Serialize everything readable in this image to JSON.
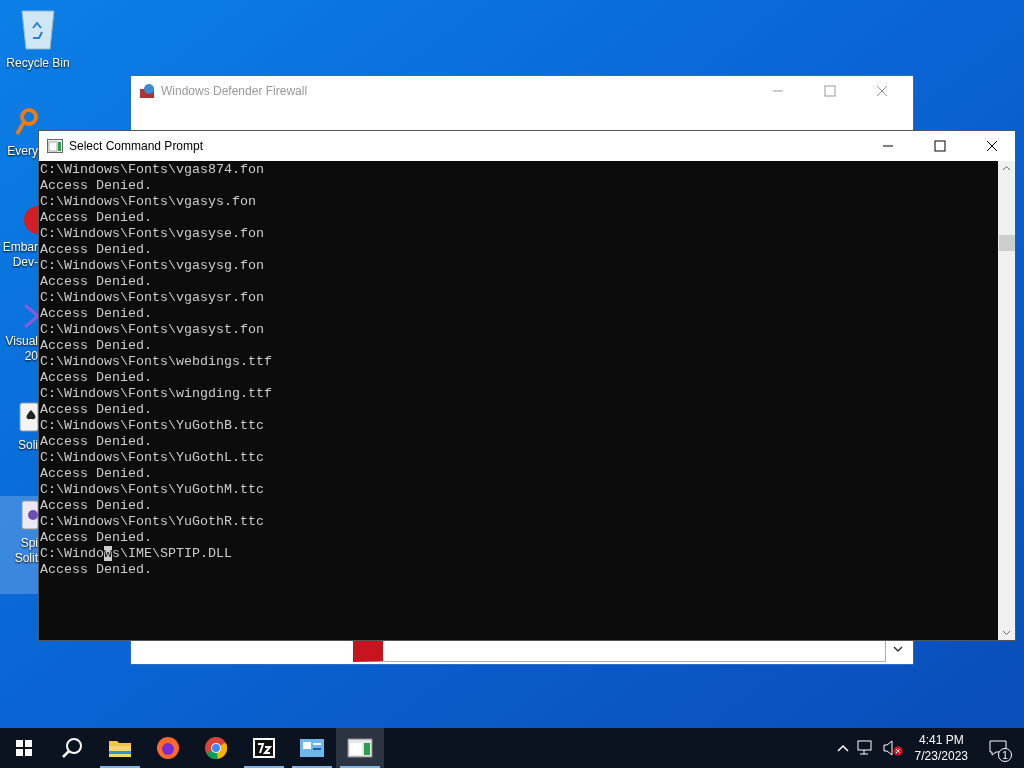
{
  "desktop_icons": [
    {
      "kind": "recycle",
      "lines": [
        "Recycle Bin"
      ],
      "selected": false
    },
    {
      "kind": "search",
      "lines": [
        "Every"
      ],
      "selected": false
    },
    {
      "kind": "devcpp",
      "lines": [
        "Embar",
        "Dev-"
      ],
      "selected": false
    },
    {
      "kind": "visual",
      "lines": [
        "Visual",
        "20"
      ],
      "selected": false
    },
    {
      "kind": "cards",
      "lines": [
        "Soli"
      ],
      "selected": false
    },
    {
      "kind": "spider",
      "lines": [
        "Spi",
        "Solit"
      ],
      "selected": true
    }
  ],
  "firewall_window": {
    "title": "Windows Defender Firewall"
  },
  "command_window": {
    "title": "Select Command Prompt",
    "lines": [
      {
        "segments": [
          {
            "text": "C:\\Windows\\Fonts\\vgas874.fon",
            "selected": false
          }
        ]
      },
      {
        "segments": [
          {
            "text": "Access Denied.",
            "selected": false
          }
        ]
      },
      {
        "segments": [
          {
            "text": "C:\\Windows\\Fonts\\vgasys.fon",
            "selected": false
          }
        ]
      },
      {
        "segments": [
          {
            "text": "Access Denied.",
            "selected": false
          }
        ]
      },
      {
        "segments": [
          {
            "text": "C:\\Windows\\Fonts\\vgasyse.fon",
            "selected": false
          }
        ]
      },
      {
        "segments": [
          {
            "text": "Access Denied.",
            "selected": false
          }
        ]
      },
      {
        "segments": [
          {
            "text": "C:\\Windows\\Fonts\\vgasysg.fon",
            "selected": false
          }
        ]
      },
      {
        "segments": [
          {
            "text": "Access Denied.",
            "selected": false
          }
        ]
      },
      {
        "segments": [
          {
            "text": "C:\\Windows\\Fonts\\vgasysr.fon",
            "selected": false
          }
        ]
      },
      {
        "segments": [
          {
            "text": "Access Denied.",
            "selected": false
          }
        ]
      },
      {
        "segments": [
          {
            "text": "C:\\Windows\\Fonts\\vgasyst.fon",
            "selected": false
          }
        ]
      },
      {
        "segments": [
          {
            "text": "Access Denied.",
            "selected": false
          }
        ]
      },
      {
        "segments": [
          {
            "text": "C:\\Windows\\Fonts\\webdings.ttf",
            "selected": false
          }
        ]
      },
      {
        "segments": [
          {
            "text": "Access Denied.",
            "selected": false
          }
        ]
      },
      {
        "segments": [
          {
            "text": "C:\\Windows\\Fonts\\wingding.ttf",
            "selected": false
          }
        ]
      },
      {
        "segments": [
          {
            "text": "Access Denied.",
            "selected": false
          }
        ]
      },
      {
        "segments": [
          {
            "text": "C:\\Windows\\Fonts\\YuGothB.ttc",
            "selected": false
          }
        ]
      },
      {
        "segments": [
          {
            "text": "Access Denied.",
            "selected": false
          }
        ]
      },
      {
        "segments": [
          {
            "text": "C:\\Windows\\Fonts\\YuGothL.ttc",
            "selected": false
          }
        ]
      },
      {
        "segments": [
          {
            "text": "Access Denied.",
            "selected": false
          }
        ]
      },
      {
        "segments": [
          {
            "text": "C:\\Windows\\Fonts\\YuGothM.ttc",
            "selected": false
          }
        ]
      },
      {
        "segments": [
          {
            "text": "Access Denied.",
            "selected": false
          }
        ]
      },
      {
        "segments": [
          {
            "text": "C:\\Windows\\Fonts\\YuGothR.ttc",
            "selected": false
          }
        ]
      },
      {
        "segments": [
          {
            "text": "Access Denied.",
            "selected": false
          }
        ]
      },
      {
        "segments": [
          {
            "text": "C:\\Windo",
            "selected": false
          },
          {
            "text": "w",
            "selected": true
          },
          {
            "text": "s\\IME\\SPTIP.DLL",
            "selected": false
          }
        ]
      },
      {
        "segments": [
          {
            "text": "Access Denied.",
            "selected": false
          }
        ]
      }
    ]
  },
  "taskbar": {
    "items": [
      {
        "kind": "explorer",
        "running": true,
        "selected": false
      },
      {
        "kind": "firefox",
        "running": false,
        "selected": false
      },
      {
        "kind": "chrome",
        "running": false,
        "selected": false
      },
      {
        "kind": "sevenzip",
        "running": true,
        "selected": false
      },
      {
        "kind": "control",
        "running": true,
        "selected": false
      },
      {
        "kind": "console",
        "running": true,
        "selected": true
      }
    ],
    "time": "4:41 PM",
    "date": "7/23/2023",
    "notification_count": "1"
  }
}
